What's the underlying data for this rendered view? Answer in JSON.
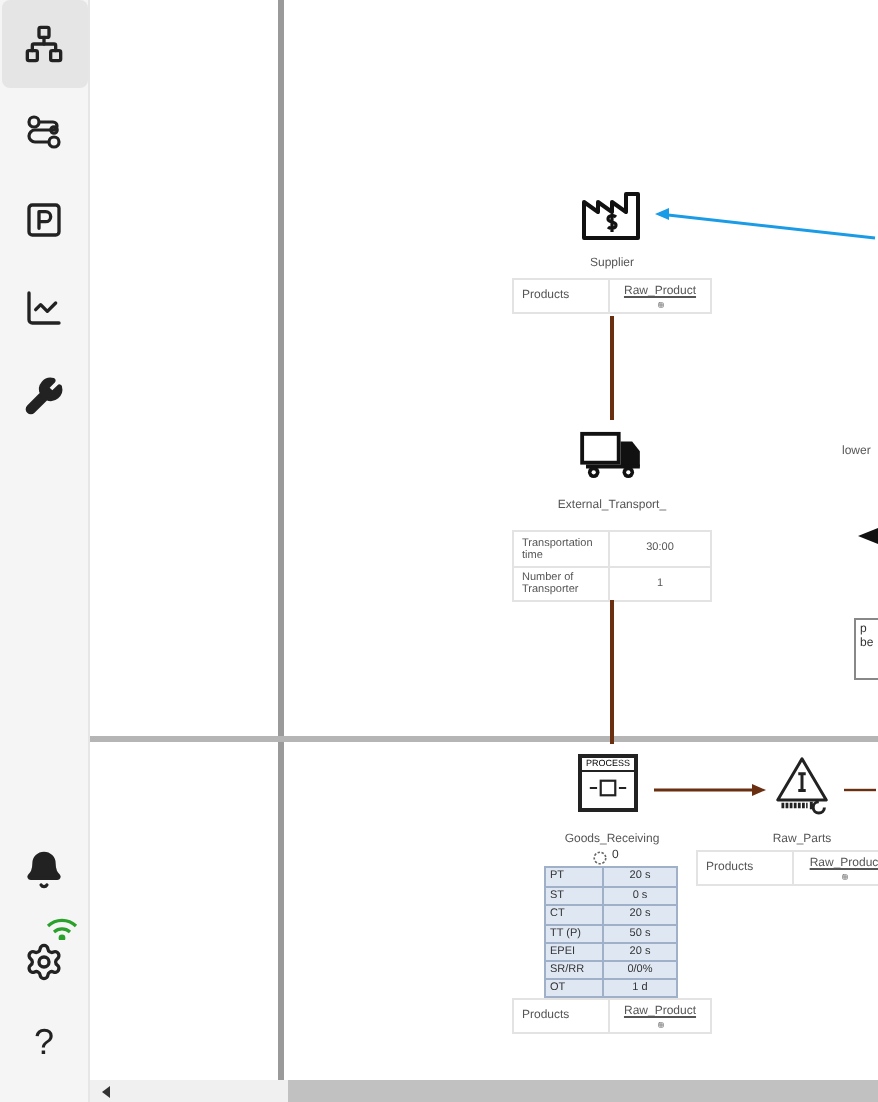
{
  "sidebar": {
    "top": [
      {
        "kind": "hierarchy",
        "selected": true
      },
      {
        "kind": "route",
        "selected": false
      },
      {
        "kind": "parking",
        "selected": false
      },
      {
        "kind": "chart",
        "selected": false
      },
      {
        "kind": "wrench",
        "selected": false
      }
    ],
    "bottom": [
      {
        "kind": "bell"
      },
      {
        "kind": "settings",
        "connected": true
      },
      {
        "kind": "help",
        "label": "?"
      }
    ]
  },
  "diagram": {
    "supplier": {
      "label": "Supplier",
      "products_label": "Products",
      "product": "Raw_Product"
    },
    "external_transport": {
      "label": "External_Transport_",
      "rows": [
        {
          "name": "Transportation time",
          "value": "30:00"
        },
        {
          "name": "Number of Transporter",
          "value": "1"
        }
      ]
    },
    "goods_receiving": {
      "icon_text": "PROCESS",
      "label": "Goods_Receiving",
      "operators": "0",
      "stats": [
        {
          "name": "PT",
          "value": "20 s"
        },
        {
          "name": "ST",
          "value": "0 s"
        },
        {
          "name": "CT",
          "value": "20 s"
        },
        {
          "name": "TT (P)",
          "value": "50 s"
        },
        {
          "name": "EPEI",
          "value": "20 s"
        },
        {
          "name": "SR/RR",
          "value": "0/0%"
        },
        {
          "name": "OT",
          "value": "1 d"
        }
      ],
      "products_label": "Products",
      "product": "Raw_Product"
    },
    "raw_parts": {
      "label": "Raw_Parts",
      "products_label": "Products",
      "product": "Raw_Produc"
    },
    "offscreen": {
      "label": "lower",
      "note_lines": [
        "p",
        "be"
      ]
    }
  }
}
